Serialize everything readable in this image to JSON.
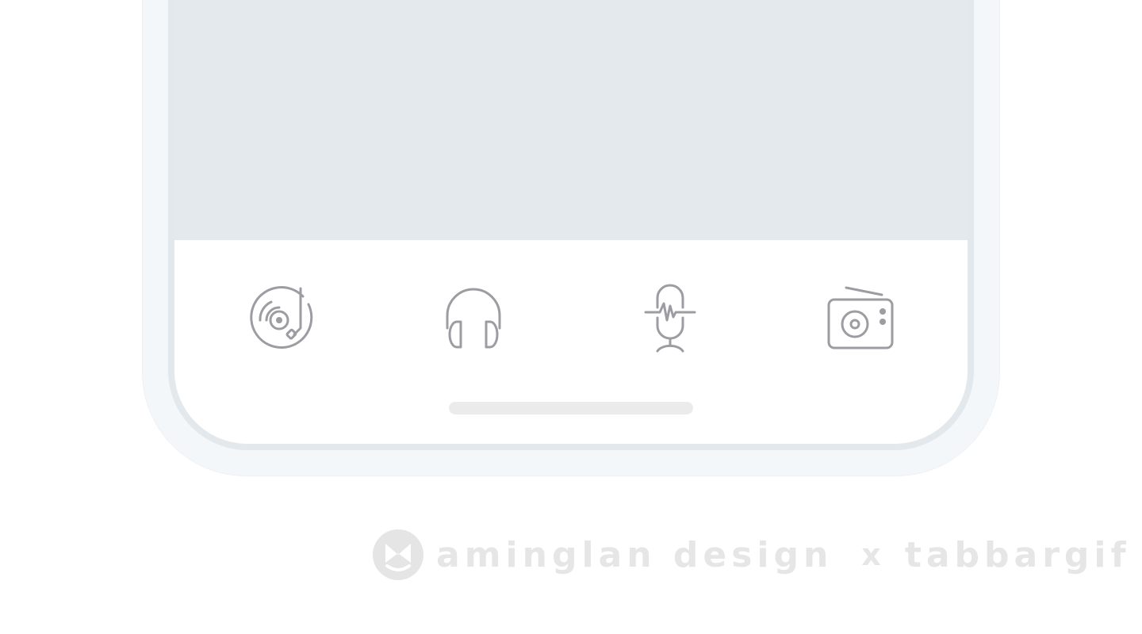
{
  "colors": {
    "icon_stroke": "#9c9ca2",
    "screen_content": "#e4e9ed",
    "frame": "#f4f7fa",
    "home_indicator": "#ebebeb",
    "watermark": "#e6e6e6"
  },
  "tab_bar": {
    "items": [
      {
        "icon": "turntable-icon"
      },
      {
        "icon": "headphones-icon"
      },
      {
        "icon": "microphone-icon"
      },
      {
        "icon": "radio-icon"
      }
    ]
  },
  "watermark": {
    "brand": "aminglan design",
    "separator": "x",
    "project": "tabbargif"
  }
}
